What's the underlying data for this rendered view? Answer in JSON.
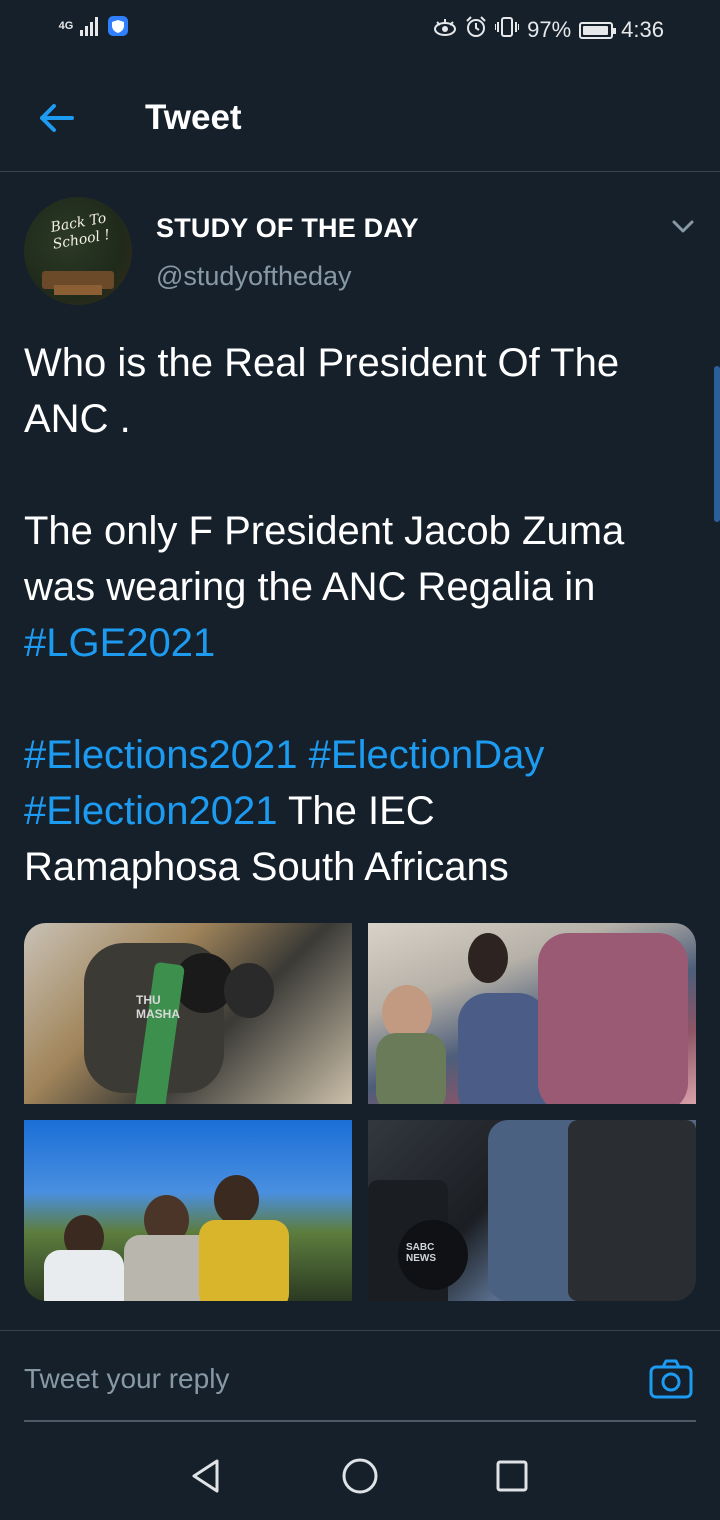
{
  "status_bar": {
    "network_type": "4G",
    "battery_percent": "97%",
    "time": "4:36",
    "battery_level": 0.97,
    "icons": [
      "signal-icon",
      "shield-icon",
      "eye-icon",
      "alarm-icon",
      "vibrate-icon",
      "battery-icon"
    ]
  },
  "header": {
    "title": "Tweet",
    "back_icon": "back-arrow-icon"
  },
  "tweet": {
    "avatar_text": "Back To School !",
    "display_name": "STUDY OF THE DAY",
    "handle": "@studyoftheday",
    "lines": [
      {
        "parts": [
          {
            "text": "Who is the Real President Of The",
            "tag": false
          }
        ]
      },
      {
        "parts": [
          {
            "text": "ANC .",
            "tag": false
          }
        ]
      },
      {
        "parts": []
      },
      {
        "parts": [
          {
            "text": "The only F President Jacob Zuma",
            "tag": false
          }
        ]
      },
      {
        "parts": [
          {
            "text": "was wearing the ANC Regalia in",
            "tag": false
          }
        ]
      },
      {
        "parts": [
          {
            "text": "#LGE2021",
            "tag": true
          }
        ]
      },
      {
        "parts": []
      },
      {
        "parts": [
          {
            "text": "#Elections2021",
            "tag": true
          },
          {
            "text": " ",
            "tag": false
          },
          {
            "text": "#ElectionDay",
            "tag": true
          }
        ]
      },
      {
        "parts": [
          {
            "text": "#Election2021",
            "tag": true
          },
          {
            "text": " The IEC",
            "tag": false
          }
        ]
      },
      {
        "parts": [
          {
            "text": "Ramaphosa South Africans",
            "tag": false
          }
        ]
      }
    ],
    "media": [
      {
        "overlay_text": "THU MASHA"
      },
      {
        "overlay_text": ""
      },
      {
        "overlay_text": ""
      },
      {
        "overlay_text": "SABC NEWS"
      }
    ]
  },
  "reply": {
    "placeholder": "Tweet your reply"
  },
  "colors": {
    "background": "#15202b",
    "accent": "#1d9bf0",
    "secondary_text": "#8899a6",
    "divider": "#38444d"
  }
}
